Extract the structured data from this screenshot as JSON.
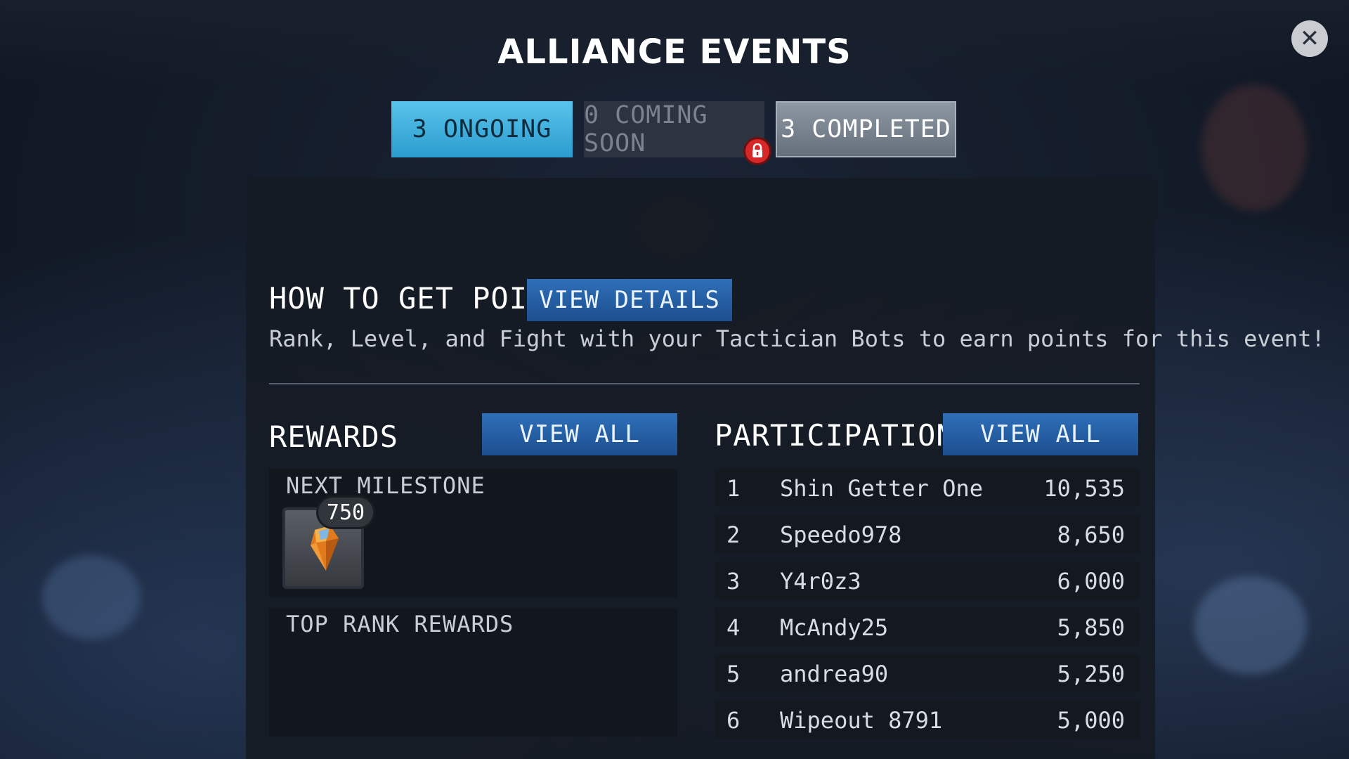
{
  "title": "ALLIANCE EVENTS",
  "close_icon": "close-icon",
  "tabs": {
    "ongoing": "3 ONGOING",
    "coming_soon": "0 COMING SOON",
    "completed": "3 COMPLETED"
  },
  "how_to": {
    "heading": "HOW TO GET POINTS",
    "button": "VIEW DETAILS",
    "description": "Rank, Level, and Fight with your Tactician Bots to earn points for this event!"
  },
  "rewards": {
    "heading": "REWARDS",
    "button": "VIEW ALL",
    "next_milestone_label": "NEXT MILESTONE",
    "milestone_points": "750",
    "reward_icon": "crystal-shard-icon",
    "top_rank_label": "TOP RANK REWARDS"
  },
  "participation": {
    "heading": "PARTICIPATION",
    "button": "VIEW ALL",
    "rows": [
      {
        "rank": "1",
        "name": "Shin Getter One",
        "points": "10,535"
      },
      {
        "rank": "2",
        "name": "Speedo978",
        "points": "8,650"
      },
      {
        "rank": "3",
        "name": "Y4r0z3",
        "points": "6,000"
      },
      {
        "rank": "4",
        "name": "McAndy25",
        "points": "5,850"
      },
      {
        "rank": "5",
        "name": "andrea90",
        "points": "5,250"
      },
      {
        "rank": "6",
        "name": "Wipeout 8791",
        "points": "5,000"
      }
    ]
  },
  "colors": {
    "active_tab": "#3fb1df",
    "button_blue": "#2563a8",
    "lock_red": "#d62828"
  }
}
